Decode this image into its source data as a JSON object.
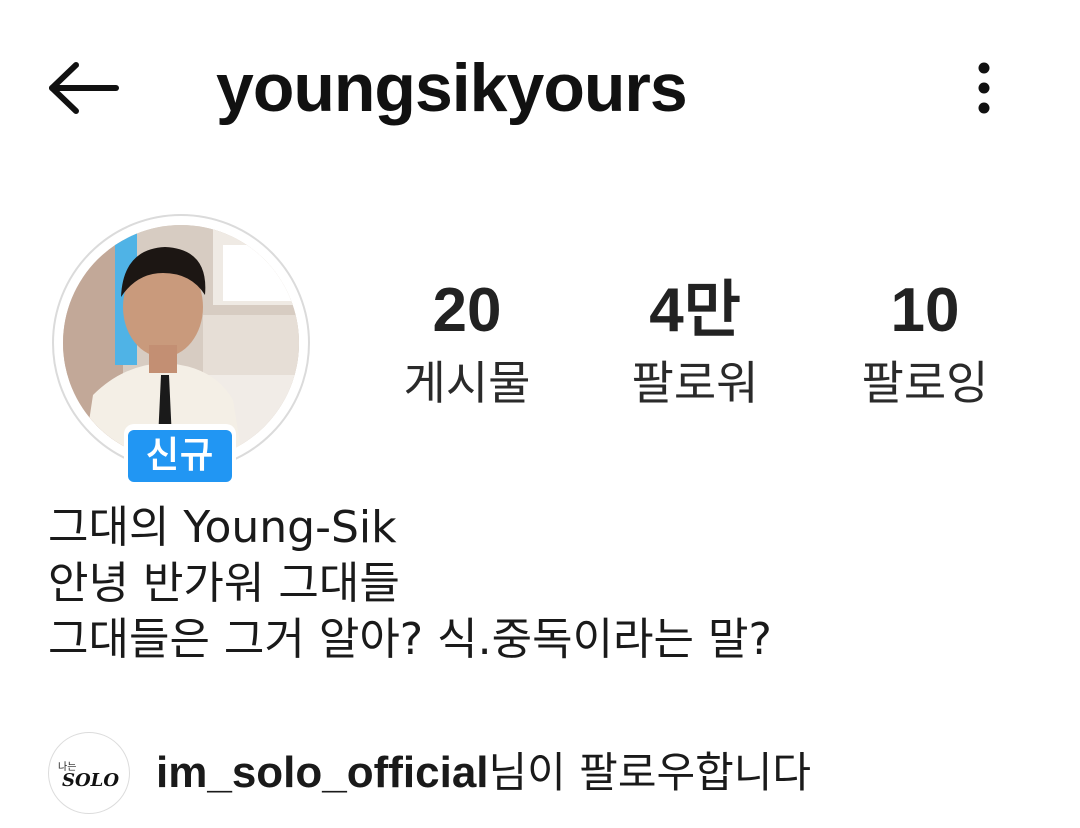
{
  "header": {
    "username": "youngsikyours",
    "back_icon": "arrow-left-icon",
    "more_icon": "more-vertical-icon"
  },
  "profile": {
    "avatar_badge": "신규",
    "badge_color": "#2196f3"
  },
  "stats": [
    {
      "value": "20",
      "label": "게시물"
    },
    {
      "value": "4만",
      "label": "팔로워"
    },
    {
      "value": "10",
      "label": "팔로잉"
    }
  ],
  "bio": {
    "lines": [
      "그대의 Young-Sik",
      "안녕 반가워 그대들",
      "그대들은 그거 알아? 식.중독이라는 말?"
    ]
  },
  "followed_by": {
    "account": "im_solo_official",
    "suffix": "님이 팔로우합니다",
    "logo_small": "나는",
    "logo_text": "SOLO"
  }
}
